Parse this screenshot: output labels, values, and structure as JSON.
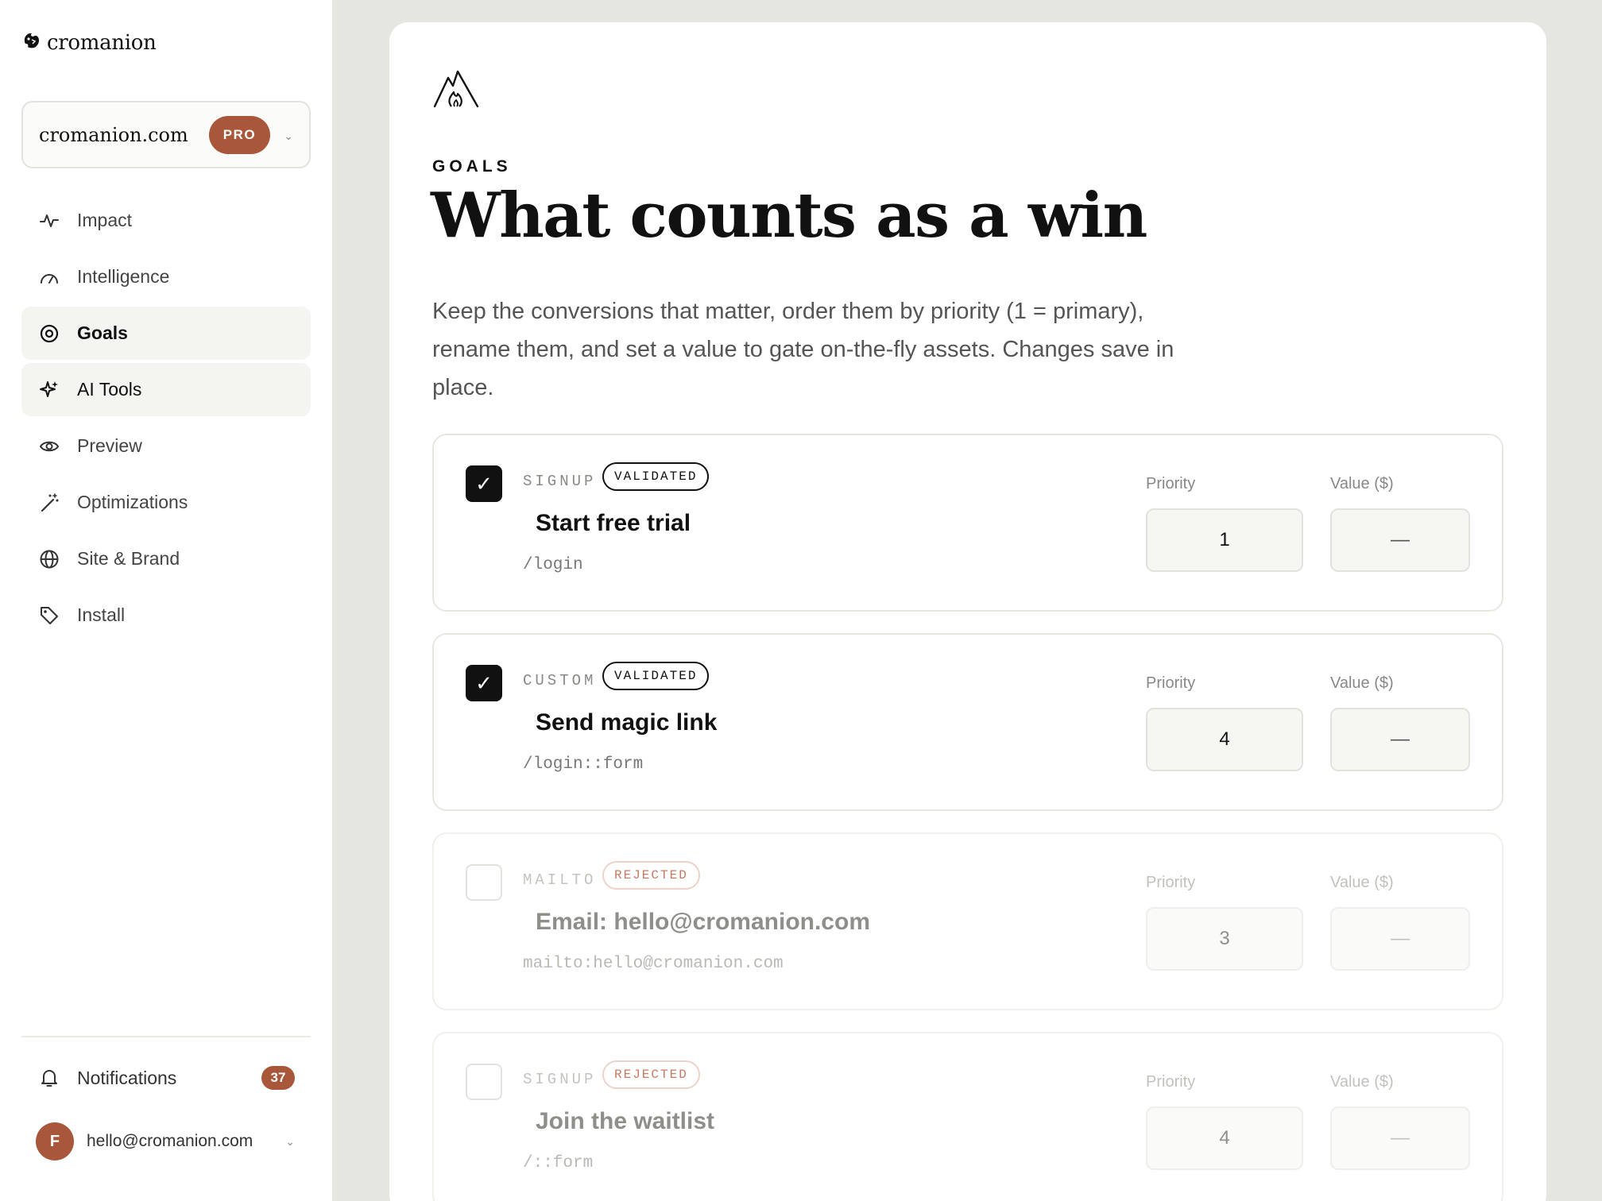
{
  "brand": {
    "name": "cromanion"
  },
  "workspace": {
    "name": "cromanion.com",
    "plan": "PRO"
  },
  "nav": [
    {
      "label": "Impact",
      "icon": "activity-icon"
    },
    {
      "label": "Intelligence",
      "icon": "gauge-icon"
    },
    {
      "label": "Goals",
      "icon": "target-icon",
      "active": true
    },
    {
      "label": "AI Tools",
      "icon": "sparkles-icon"
    },
    {
      "label": "Preview",
      "icon": "eye-icon"
    },
    {
      "label": "Optimizations",
      "icon": "magic-wand-icon"
    },
    {
      "label": "Site & Brand",
      "icon": "globe-icon"
    },
    {
      "label": "Install",
      "icon": "tag-icon"
    }
  ],
  "notifications": {
    "label": "Notifications",
    "count": "37"
  },
  "account": {
    "initial": "F",
    "email": "hello@cromanion.com"
  },
  "page": {
    "eyebrow": "GOALS",
    "title": "What counts as a win",
    "description": "Keep the conversions that matter, order them by priority (1 = primary), rename them, and set a value to gate on-the-fly assets. Changes save in place."
  },
  "field_labels": {
    "priority": "Priority",
    "value": "Value ($)"
  },
  "goals": [
    {
      "type": "SIGNUP",
      "status": "VALIDATED",
      "name": "Start free trial",
      "path": "/login",
      "priority": "1",
      "value": "—",
      "checked": true
    },
    {
      "type": "CUSTOM",
      "status": "VALIDATED",
      "name": "Send magic link",
      "path": "/login::form",
      "priority": "4",
      "value": "—",
      "checked": true
    },
    {
      "type": "MAILTO",
      "status": "REJECTED",
      "name": "Email: hello@cromanion.com",
      "path": "mailto:hello@cromanion.com",
      "priority": "3",
      "value": "—",
      "checked": false
    },
    {
      "type": "SIGNUP",
      "status": "REJECTED",
      "name": "Join the waitlist",
      "path": "/::form",
      "priority": "4",
      "value": "—",
      "checked": false
    }
  ],
  "colors": {
    "accent": "#a9573a",
    "background": "#e6e6e1",
    "rejected": "#c77a62"
  }
}
